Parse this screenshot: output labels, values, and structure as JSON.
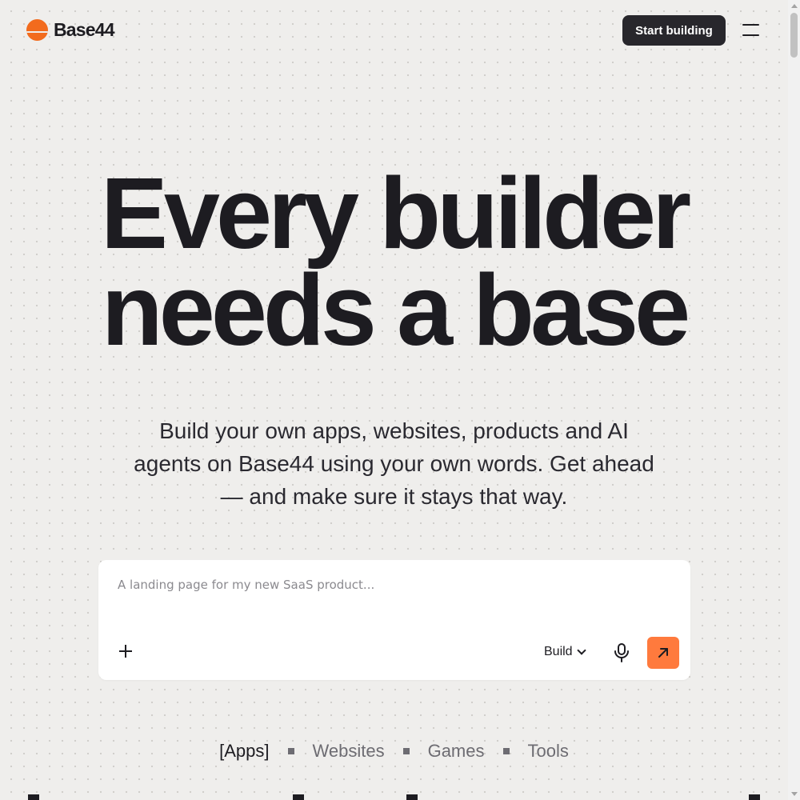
{
  "header": {
    "brand": "Base44",
    "cta_label": "Start building"
  },
  "hero": {
    "title_line1": "Every builder",
    "title_line2": "needs a base",
    "subtitle": "Build your own apps, websites, products and AI agents on Base44 using your own words. Get ahead — and make sure it stays that way."
  },
  "prompt": {
    "placeholder": "A landing page for my new SaaS product...",
    "value": "",
    "mode": "Build"
  },
  "categories": [
    "[Apps]",
    "Websites",
    "Games",
    "Tools"
  ],
  "colors": {
    "accent": "#ff7a3d",
    "brand": "#f26b1d",
    "dark": "#28272c",
    "background": "#efeeec"
  },
  "icons": {
    "logo": "sun-icon",
    "menu": "hamburger-menu-icon",
    "attach": "plus-icon",
    "mode": "chevron-down-icon",
    "voice": "microphone-icon",
    "send": "arrow-up-right-icon"
  }
}
